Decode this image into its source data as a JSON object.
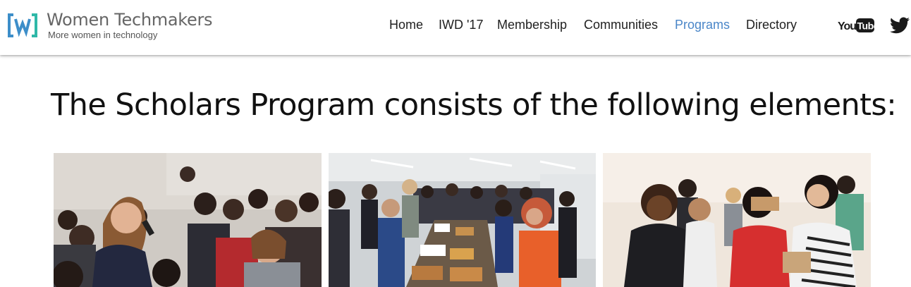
{
  "header": {
    "brand_name": "Women Techmakers",
    "tagline": "More women in technology",
    "logo_icon": "wtm-bracket-w-logo",
    "nav": [
      {
        "label": "Home",
        "active": false
      },
      {
        "label": "IWD '17",
        "active": false
      },
      {
        "label": "Membership",
        "active": false
      },
      {
        "label": "Communities",
        "active": false
      },
      {
        "label": "Programs",
        "active": true
      },
      {
        "label": "Directory",
        "active": false
      }
    ],
    "social": [
      {
        "icon": "youtube-icon"
      },
      {
        "icon": "twitter-icon"
      }
    ],
    "colors": {
      "active_nav": "#4a86c8",
      "logo_blue": "#3d8ec9",
      "logo_teal": "#2fb8a8"
    }
  },
  "main": {
    "title": "The Scholars Program consists of the following elements:",
    "photos": [
      {
        "subject": "woman-speaking-into-microphone-audience"
      },
      {
        "subject": "attendees-at-buffet-table"
      },
      {
        "subject": "women-trying-cardboard-vr-viewers"
      }
    ]
  }
}
